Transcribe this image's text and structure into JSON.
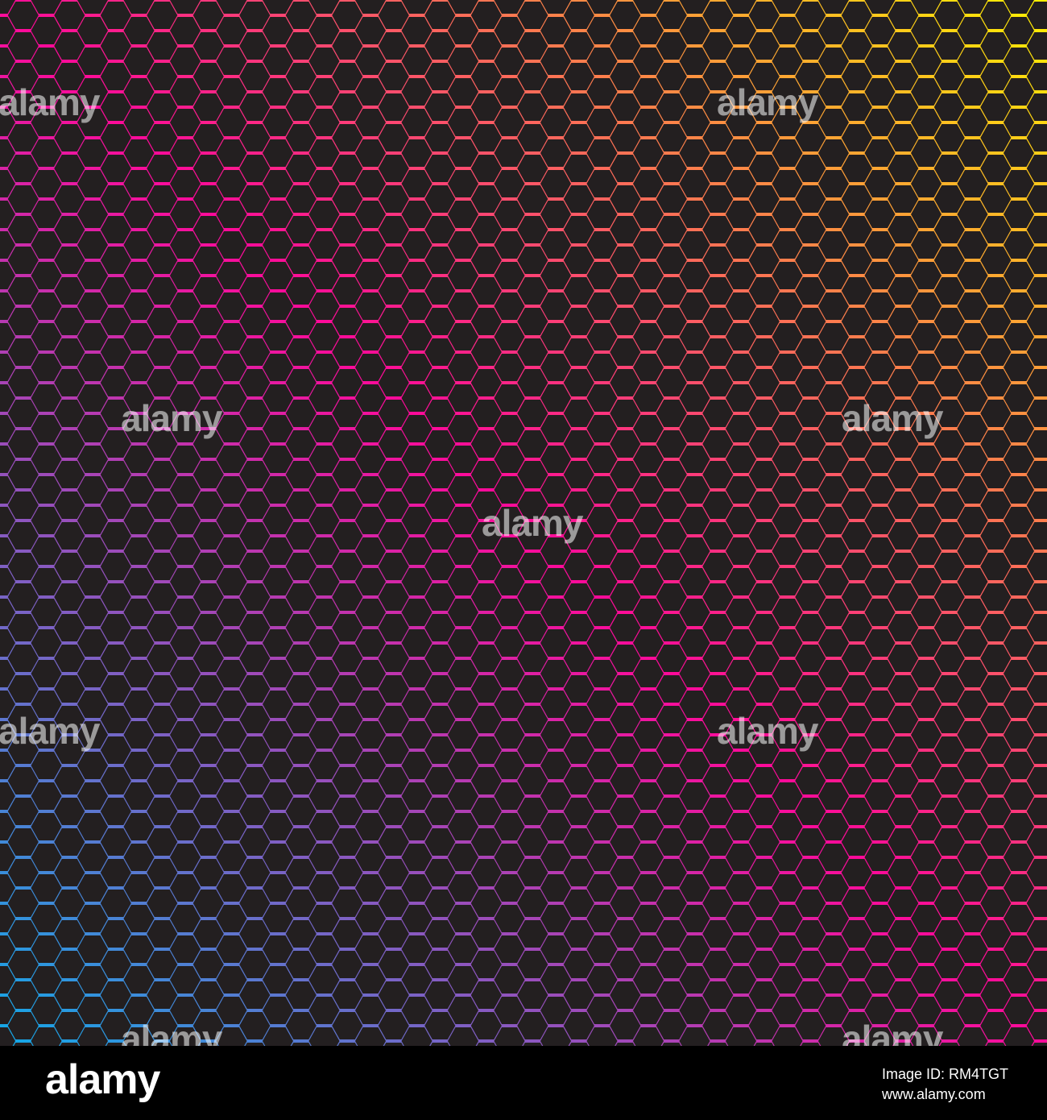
{
  "image": {
    "subject": "hexagon-grid-over-gradient",
    "colors": {
      "cyan": "#12a9e8",
      "magenta": "#ff0a9a",
      "yellow": "#fff200",
      "hexagon": "#231f20"
    }
  },
  "watermark": {
    "text": "alamy"
  },
  "footer": {
    "logo_text": "alamy",
    "image_id": "Image ID: RM4TGT",
    "url": "www.alamy.com"
  }
}
